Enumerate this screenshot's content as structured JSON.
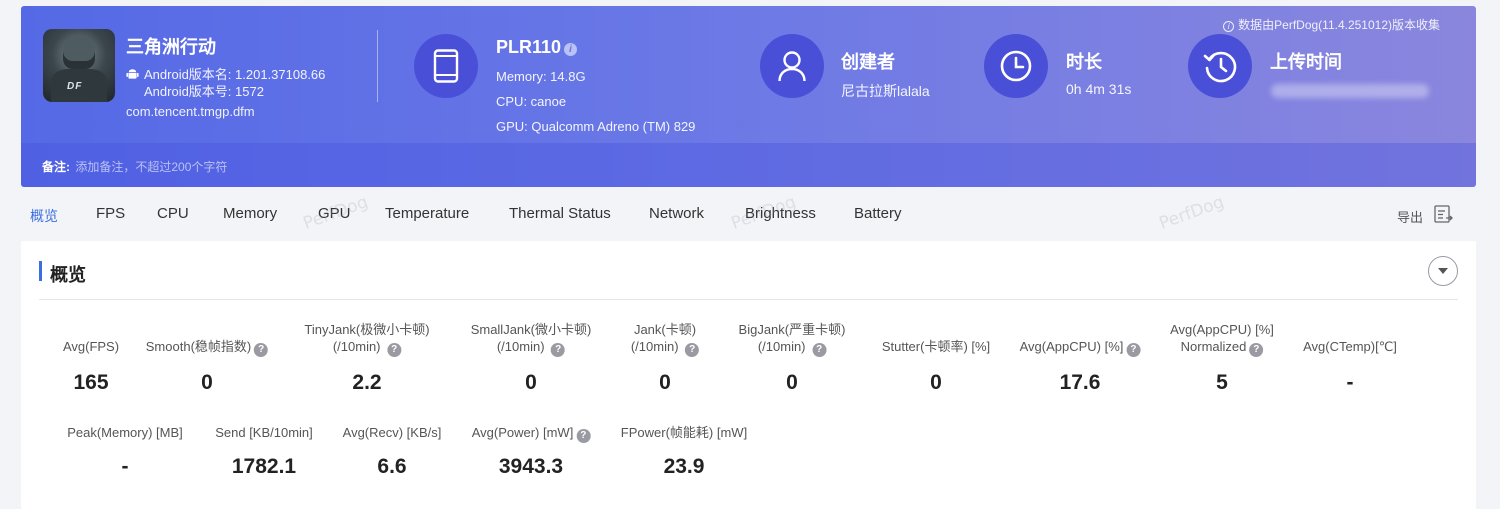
{
  "app": {
    "name": "三角洲行动",
    "android_version_name": "Android版本名: 1.201.37108.66",
    "android_version_code": "Android版本号: 1572",
    "package": "com.tencent.tmgp.dfm"
  },
  "device": {
    "model": "PLR110",
    "memory": "Memory: 14.8G",
    "cpu": "CPU: canoe",
    "gpu": "GPU: Qualcomm Adreno (TM) 829"
  },
  "creator": {
    "title": "创建者",
    "value": "尼古拉斯lalala"
  },
  "duration": {
    "title": "时长",
    "value": "0h 4m 31s"
  },
  "upload": {
    "title": "上传时间"
  },
  "collect_note": "数据由PerfDog(11.4.251012)版本收集",
  "note": {
    "label": "备注:",
    "placeholder": "添加备注，不超过200个字符"
  },
  "tabs": [
    "概览",
    "FPS",
    "CPU",
    "Memory",
    "GPU",
    "Temperature",
    "Thermal Status",
    "Network",
    "Brightness",
    "Battery"
  ],
  "export_label": "导出",
  "watermark": "PerfDog",
  "card": {
    "title": "概览"
  },
  "metrics": [
    {
      "label1": "Avg(FPS)",
      "label2": "",
      "help": false,
      "value": "165"
    },
    {
      "label1": "Smooth(稳帧指数)",
      "label2": "",
      "help": true,
      "value": "0"
    },
    {
      "label1": "TinyJank(极微小卡顿)",
      "label2": "(/10min)",
      "help": true,
      "value": "2.2"
    },
    {
      "label1": "SmallJank(微小卡顿)",
      "label2": "(/10min)",
      "help": true,
      "value": "0"
    },
    {
      "label1": "Jank(卡顿)",
      "label2": "(/10min)",
      "help": true,
      "value": "0"
    },
    {
      "label1": "BigJank(严重卡顿)",
      "label2": "(/10min)",
      "help": true,
      "value": "0"
    },
    {
      "label1": "Stutter(卡顿率) [%]",
      "label2": "",
      "help": false,
      "value": "0"
    },
    {
      "label1": "Avg(AppCPU) [%]",
      "label2": "",
      "help": true,
      "value": "17.6"
    },
    {
      "label1": "Avg(AppCPU) [%]",
      "label2": "Normalized",
      "help": true,
      "value": "5"
    },
    {
      "label1": "Avg(CTemp)[℃]",
      "label2": "",
      "help": false,
      "value": "-"
    },
    {
      "label1": "Peak(Memory) [MB]",
      "label2": "",
      "help": false,
      "value": "-"
    },
    {
      "label1": "Send [KB/10min]",
      "label2": "",
      "help": false,
      "value": "1782.1"
    },
    {
      "label1": "Avg(Recv) [KB/s]",
      "label2": "",
      "help": false,
      "value": "6.6"
    },
    {
      "label1": "Avg(Power) [mW]",
      "label2": "",
      "help": true,
      "value": "3943.3"
    },
    {
      "label1": "FPower(帧能耗) [mW]",
      "label2": "",
      "help": false,
      "value": "23.9"
    }
  ],
  "icons": {
    "device": "phone-icon",
    "creator": "user-icon",
    "duration": "clock-icon",
    "upload": "history-icon",
    "export": "export-icon",
    "collapse": "chevron-down-icon"
  },
  "colors": {
    "accent": "#3b6fe0",
    "banner_start": "#5569e6",
    "banner_end": "#8a86de",
    "icon_circle": "#4a4fd8"
  }
}
